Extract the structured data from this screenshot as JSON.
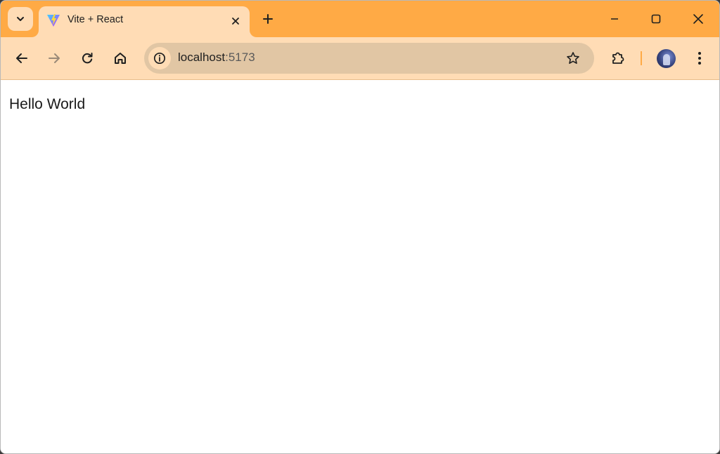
{
  "browser": {
    "tab": {
      "title": "Vite + React",
      "favicon": "vite-logo-icon"
    },
    "address_bar": {
      "host": "localhost",
      "port": ":5173"
    },
    "icons": {
      "tab_search": "chevron-down-icon",
      "tab_close": "close-icon",
      "new_tab": "plus-icon",
      "minimize": "minimize-icon",
      "maximize": "maximize-icon",
      "close_window": "close-icon",
      "back": "arrow-left-icon",
      "forward": "arrow-right-icon",
      "reload": "reload-icon",
      "home": "home-icon",
      "site_info": "info-icon",
      "bookmark": "star-icon",
      "extensions": "puzzle-icon",
      "menu": "kebab-menu-icon"
    },
    "colors": {
      "frame": "#ffaa45",
      "toolbar": "#ffdcb5",
      "omnibox": "#e1c6a4"
    }
  },
  "page": {
    "text": "Hello World"
  }
}
